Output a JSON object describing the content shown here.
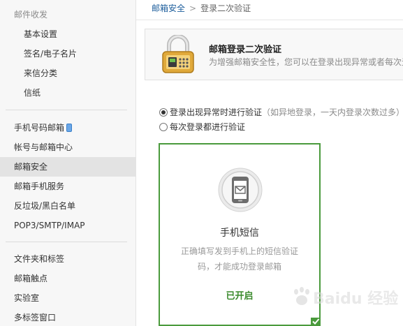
{
  "breadcrumb": {
    "link": "邮箱安全",
    "separator": ">",
    "current": "登录二次验证"
  },
  "sidebar": {
    "section_title": "邮件收发",
    "sub_items": [
      {
        "label": "基本设置"
      },
      {
        "label": "签名/电子名片"
      },
      {
        "label": "来信分类"
      },
      {
        "label": "信纸"
      }
    ],
    "main_items": [
      {
        "label": "手机号码邮箱",
        "icon": "phone-icon"
      },
      {
        "label": "帐号与邮箱中心"
      },
      {
        "label": "邮箱安全",
        "active": true
      },
      {
        "label": "邮箱手机服务"
      },
      {
        "label": "反垃圾/黑白名单"
      },
      {
        "label": "POP3/SMTP/IMAP"
      }
    ],
    "bottom_items": [
      {
        "label": "文件夹和标签"
      },
      {
        "label": "邮箱触点"
      },
      {
        "label": "实验室"
      },
      {
        "label": "多标签窗口"
      }
    ]
  },
  "header": {
    "title": "邮箱登录二次验证",
    "description": "为增强邮箱安全性，您可以在登录出现异常或者每次无",
    "icon": "lock-icon"
  },
  "options": [
    {
      "label": "登录出现异常时进行验证",
      "hint": "（如异地登录，一天内登录次数过多）",
      "checked": true
    },
    {
      "label": "每次登录都进行验证",
      "hint": "",
      "checked": false
    }
  ],
  "card": {
    "icon": "phone-message-icon",
    "title": "手机短信",
    "description": "正确填写发到手机上的短信验证码，才能成功登录邮箱",
    "status": "已开启",
    "selected": true
  },
  "watermark": {
    "text": "Baidu 经验"
  },
  "colors": {
    "accent_green": "#4a9a3c",
    "link_blue": "#1d5e9c",
    "active_bg": "#e3e3e3"
  }
}
